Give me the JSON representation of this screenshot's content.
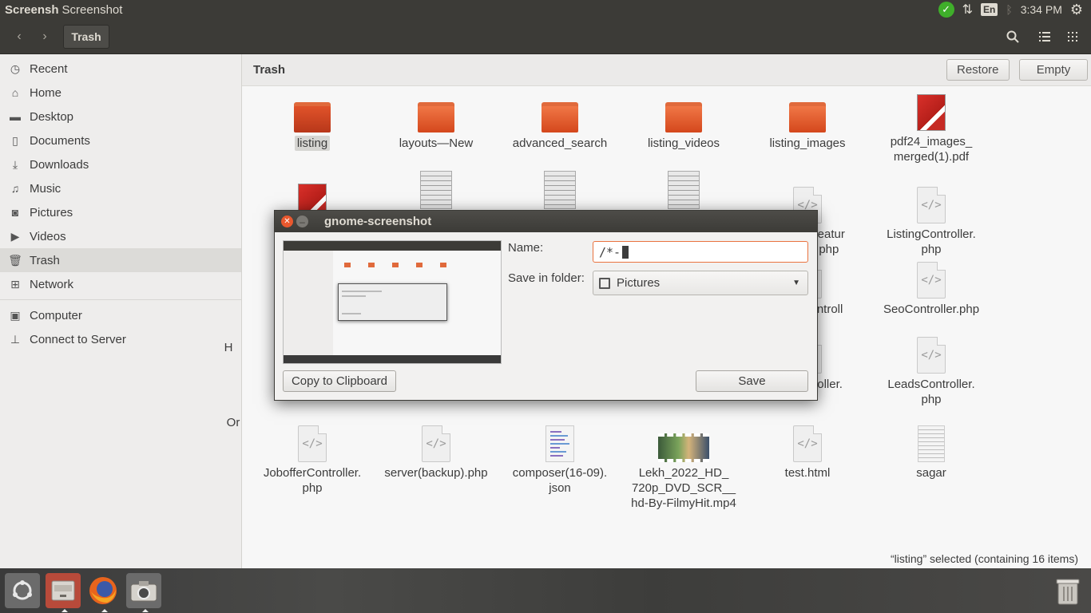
{
  "top_panel": {
    "app_name": "Screensh",
    "window_title": "Screenshot",
    "lang": "En",
    "time": "3:34 PM"
  },
  "header": {
    "back_icon": "‹",
    "forward_icon": "›",
    "location": "Trash"
  },
  "sidebar": {
    "items": [
      {
        "label": "Recent",
        "icon": "clock-icon"
      },
      {
        "label": "Home",
        "icon": "home-icon"
      },
      {
        "label": "Desktop",
        "icon": "folder-icon"
      },
      {
        "label": "Documents",
        "icon": "document-icon"
      },
      {
        "label": "Downloads",
        "icon": "download-icon"
      },
      {
        "label": "Music",
        "icon": "music-icon"
      },
      {
        "label": "Pictures",
        "icon": "camera-icon"
      },
      {
        "label": "Videos",
        "icon": "video-icon"
      },
      {
        "label": "Trash",
        "icon": "trash-icon"
      },
      {
        "label": "Network",
        "icon": "network-icon"
      }
    ],
    "devices": [
      {
        "label": "Computer",
        "icon": "computer-icon"
      },
      {
        "label": "Connect to Server",
        "icon": "server-icon"
      }
    ]
  },
  "main": {
    "title": "Trash",
    "restore_label": "Restore",
    "empty_label": "Empty",
    "files": {
      "listing": "listing",
      "layouts": "layouts—New",
      "advanced_search": "advanced_search",
      "listing_videos": "listing_videos",
      "listing_images": "listing_images",
      "pdf24_line1": "pdf24_images_",
      "pdf24_line2": "merged(1).pdf",
      "offer_line1": "erFeatur",
      "offer_line2": "er.php",
      "listingctrl_line1": "ListingController.",
      "listingctrl_line2": "php",
      "controll_line1": "Controll",
      "controll_line2": "p",
      "seo": "SeoController.php",
      "troller": "troller.",
      "leads_line1": "LeadsController.",
      "leads_line2": "php",
      "h_frag": "H",
      "or_frag": "Or",
      "php_frag": "php",
      "joboffer_line1": "JobofferController.",
      "joboffer_line2": "php",
      "server_backup": "server(backup).php",
      "composer_line1": "composer(16-09).",
      "composer_line2": "json",
      "lekh_line1": "Lekh_2022_HD_",
      "lekh_line2": "720p_DVD_SCR__",
      "lekh_line3": "hd-By-FilmyHit.mp4",
      "test": "test.html",
      "sagar": "sagar"
    },
    "status": "“listing” selected  (containing 16 items)"
  },
  "dialog": {
    "title": "gnome-screenshot",
    "name_label": "Name:",
    "name_value": "/*-",
    "folder_label": "Save in folder:",
    "folder_value": "Pictures",
    "copy_label": "Copy to Clipboard",
    "save_label": "Save"
  },
  "colors": {
    "panel": "#3c3b37",
    "accent": "#e9582e",
    "folder": "#e06a3c",
    "selected": "#dcdbd8"
  }
}
